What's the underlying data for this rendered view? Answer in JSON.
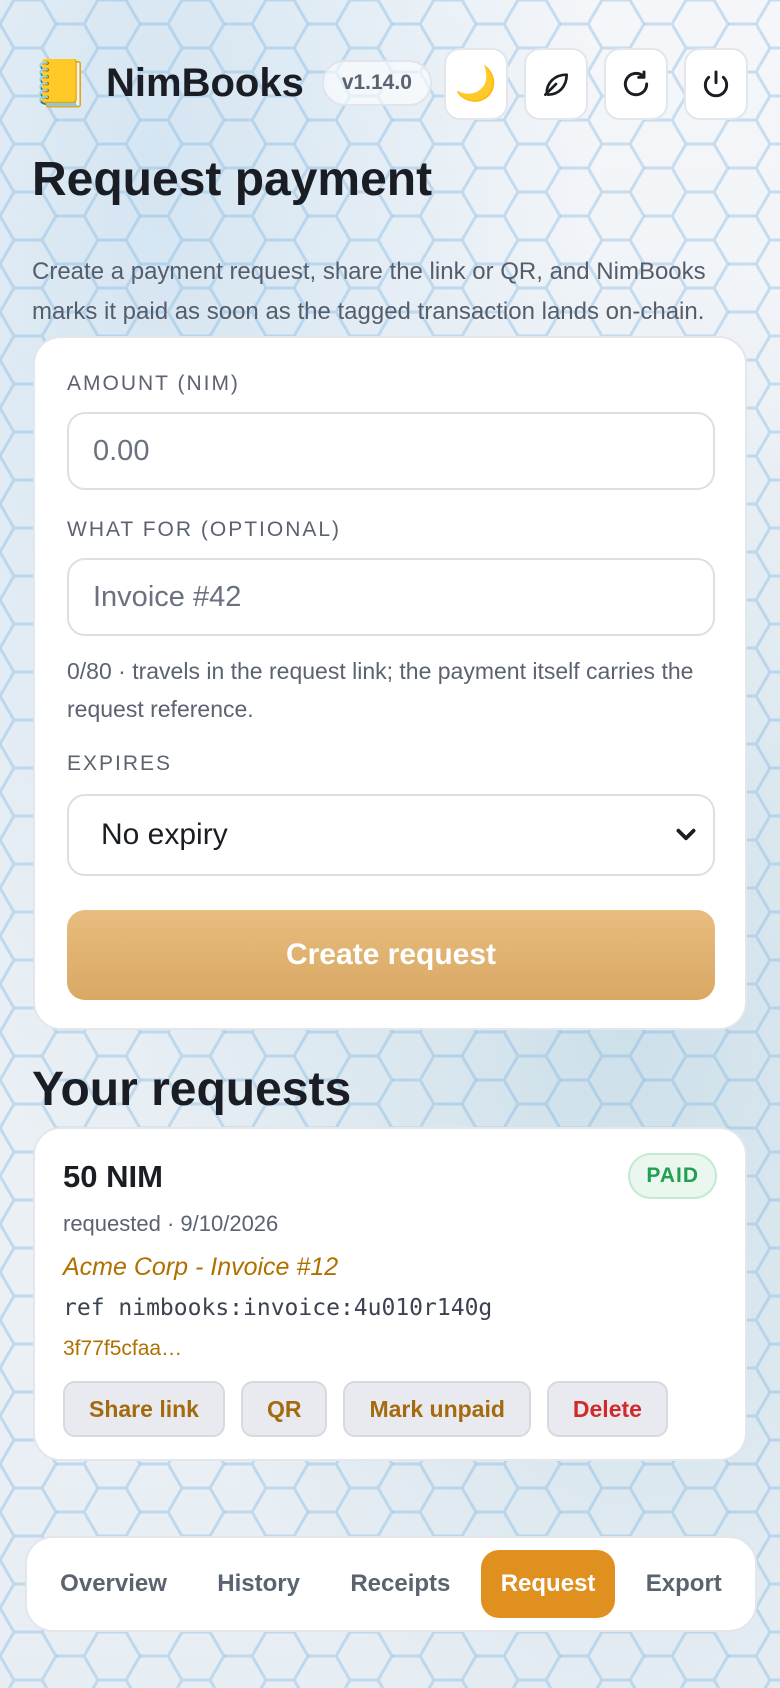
{
  "app": {
    "logo_icon": "📒",
    "title": "NimBooks",
    "version": "v1.14.0"
  },
  "header_icons": [
    {
      "name": "moon-icon",
      "glyph": "🌙"
    },
    {
      "name": "leaf-icon"
    },
    {
      "name": "refresh-icon"
    },
    {
      "name": "power-icon"
    }
  ],
  "page": {
    "title": "Request payment",
    "description": "Create a payment request, share the link or QR, and NimBooks marks it paid as soon as the tagged transaction lands on-chain."
  },
  "form": {
    "amount_label": "AMOUNT (NIM)",
    "amount_placeholder": "0.00",
    "memo_label": "WHAT FOR (OPTIONAL)",
    "memo_placeholder": "Invoice #42",
    "memo_hint": "0/80 · travels in the request link; the payment itself carries the request reference.",
    "expires_label": "EXPIRES",
    "expires_value": "No expiry",
    "create_label": "Create request"
  },
  "requests": {
    "title": "Your requests",
    "items": [
      {
        "amount": "50 NIM",
        "status": "PAID",
        "meta": "requested · 9/10/2026",
        "memo": "Acme Corp - Invoice #12",
        "ref": "ref nimbooks:invoice:4u010r140g",
        "tx": "3f77f5cfaa…",
        "actions": {
          "share": "Share link",
          "qr": "QR",
          "unpaid": "Mark unpaid",
          "delete": "Delete"
        }
      }
    ]
  },
  "tabs": [
    {
      "label": "Overview",
      "active": false
    },
    {
      "label": "History",
      "active": false
    },
    {
      "label": "Receipts",
      "active": false
    },
    {
      "label": "Request",
      "active": true
    },
    {
      "label": "Export",
      "active": false
    }
  ],
  "colors": {
    "accent": "#e0901e",
    "paid": "#22a052",
    "danger": "#d02a2a",
    "memo": "#b07000"
  }
}
